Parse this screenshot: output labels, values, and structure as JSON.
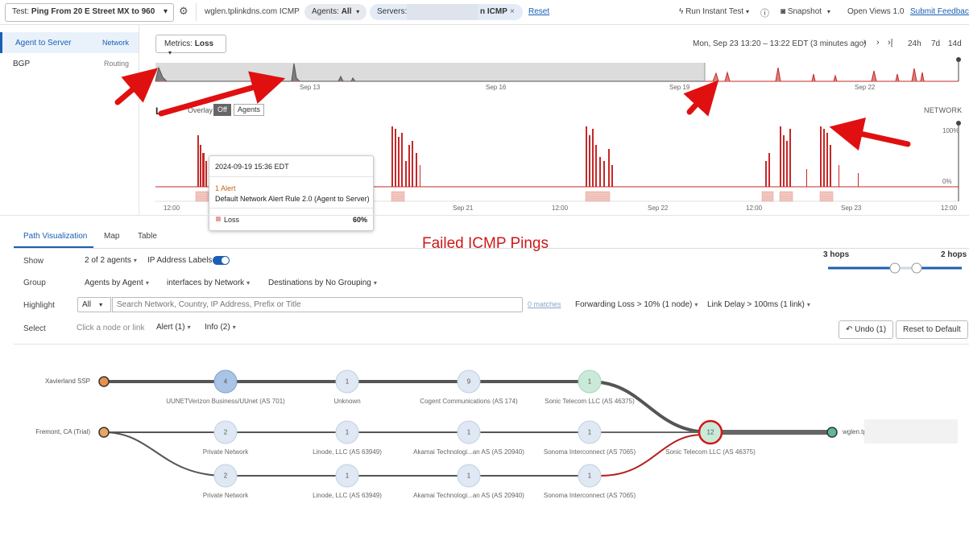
{
  "topbar": {
    "test_label": "Test:",
    "test_name": "Ping From 20 E Street MX to 960",
    "target": "wglen.tplinkdns.com ICMP",
    "agents_label": "Agents:",
    "agents_value": "All",
    "servers_label": "Servers:",
    "servers_value": "n ICMP",
    "reset": "Reset",
    "run_instant_test": "Run Instant Test",
    "snapshot": "Snapshot",
    "open_views": "Open Views 1.0",
    "submit_feedback": "Submit Feedback"
  },
  "sidebar": {
    "items": [
      {
        "label": "Agent to Server",
        "category": "Network"
      },
      {
        "label": "BGP",
        "category": "Routing"
      }
    ]
  },
  "timeline": {
    "metrics_label": "Metrics:",
    "metrics_value": "Loss",
    "range_text": "Mon, Sep 23 13:20 – 13:22 EDT (3 minutes ago)",
    "range_buttons": [
      "24h",
      "7d",
      "14d"
    ],
    "overview_ticks": [
      "Sep 13",
      "Sep 16",
      "Sep 19",
      "Sep 22"
    ],
    "chart_title": "L",
    "overlay_label": "Overlay",
    "overlay_off": "Off",
    "overlay_agents": "Agents",
    "network_label": "NETWORK",
    "y_top": "100%",
    "y_bottom": "0%",
    "x_ticks": [
      "12:00",
      "Sep 21",
      "12:00",
      "Sep 22",
      "12:00",
      "Sep 23",
      "12:00"
    ]
  },
  "tooltip": {
    "date": "2024-09-19 15:36 EDT",
    "alert": "1 Alert",
    "rule": "Default Network Alert Rule 2.0 (Agent to Server)",
    "metric": "Loss",
    "value": "60%"
  },
  "tabs": [
    "Path Visualization",
    "Map",
    "Table"
  ],
  "annotation": "Failed ICMP Pings",
  "filters": {
    "show_label": "Show",
    "show_value": "2 of 2 agents",
    "ip_labels": "IP Address Labels",
    "group_label": "Group",
    "group_values": [
      "Agents by Agent",
      "interfaces by Network",
      "Destinations by No Grouping"
    ],
    "highlight_label": "Highlight",
    "highlight_scope": "All",
    "search_placeholder": "Search Network, Country, IP Address, Prefix or Title",
    "matches": "0 matches",
    "forwarding_loss": "Forwarding Loss > 10%  (1 node)",
    "link_delay": "Link Delay > 100ms  (1 link)",
    "select_label": "Select",
    "select_hint": "Click a node or link",
    "alert_filter": "Alert (1)",
    "info_filter": "Info (2)",
    "hops_left": "3 hops",
    "hops_right": "2 hops",
    "undo": "Undo (1)",
    "reset_default": "Reset to Default"
  },
  "path": {
    "agents": [
      "Xavierland SSP",
      "Fremont, CA (Trial)"
    ],
    "row1": [
      {
        "count": "4",
        "label": "UUNETVerizon Business/UUnet (AS 701)"
      },
      {
        "count": "1",
        "label": "Unknown"
      },
      {
        "count": "9",
        "label": "Cogent Communications (AS 174)"
      },
      {
        "count": "1",
        "label": "Sonic Telecom LLC (AS 46375)"
      }
    ],
    "row2": [
      {
        "count": "2",
        "label": "Private Network"
      },
      {
        "count": "1",
        "label": "Linode, LLC (AS 63949)"
      },
      {
        "count": "1",
        "label": "Akamai Technologi...an AS (AS 20940)"
      },
      {
        "count": "1",
        "label": "Sonoma Interconnect (AS 7065)"
      }
    ],
    "row3": [
      {
        "count": "2",
        "label": "Private Network"
      },
      {
        "count": "1",
        "label": "Linode, LLC (AS 63949)"
      },
      {
        "count": "1",
        "label": "Akamai Technologi...an AS (AS 20940)"
      },
      {
        "count": "1",
        "label": "Sonoma Interconnect (AS 7065)"
      }
    ],
    "merge_node": {
      "count": "12",
      "label": "Sonic Telecom LLC (AS 46375)"
    },
    "destination": "wglen.tp"
  },
  "colors": {
    "accent": "#1a5fb4",
    "loss_red": "#c62828",
    "arrow_red": "#e01010",
    "agent_orange": "#e8904a",
    "dest_green": "#5fb89a"
  }
}
